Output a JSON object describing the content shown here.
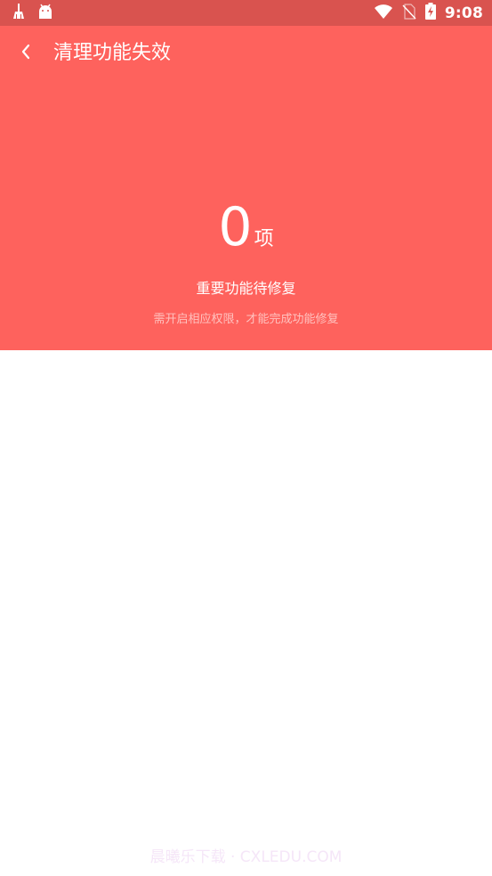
{
  "status_bar": {
    "time": "9:08",
    "icons_left": [
      "cleaner-broom-icon",
      "android-icon"
    ],
    "icons_right": [
      "wifi-icon",
      "no-sim-icon",
      "battery-charging-icon"
    ],
    "background_color": "#d9534f"
  },
  "header": {
    "back_icon": "chevron-left-icon",
    "title": "清理功能失效"
  },
  "summary": {
    "count": "0",
    "unit": "项",
    "subtitle": "重要功能待修复",
    "hint": "需开启相应权限，才能完成功能修复"
  },
  "colors": {
    "accent": "#fe625d",
    "status_bar": "#d9534f",
    "hint_text": "#ffc2bf"
  },
  "watermark": {
    "text": "晨曦乐下载 · CXLEDU.COM"
  }
}
